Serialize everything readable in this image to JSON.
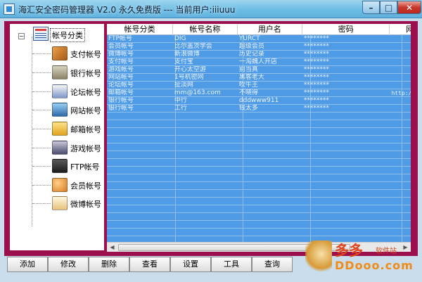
{
  "window": {
    "title": "海汇安全密码管理器 V2.0 永久免费版 --- 当前用户:iiiuuu",
    "minimize_glyph": "–",
    "maximize_glyph": "□",
    "close_glyph": "✕"
  },
  "tree": {
    "expander": "−",
    "root_label": "帐号分类",
    "root_icon": "category-list-icon",
    "items": [
      {
        "label": "支付帐号",
        "icon": "payment-icon"
      },
      {
        "label": "银行帐号",
        "icon": "bank-icon"
      },
      {
        "label": "论坛帐号",
        "icon": "forum-icon"
      },
      {
        "label": "网站帐号",
        "icon": "website-icon"
      },
      {
        "label": "邮箱帐号",
        "icon": "mailbox-icon"
      },
      {
        "label": "游戏帐号",
        "icon": "gamepad-icon"
      },
      {
        "label": "FTP帐号",
        "icon": "ftp-icon"
      },
      {
        "label": "会员帐号",
        "icon": "member-icon"
      },
      {
        "label": "微博帐号",
        "icon": "weibo-icon"
      }
    ]
  },
  "table": {
    "columns": [
      "帐号分类",
      "帐号名称",
      "用户名",
      "密码",
      "网"
    ],
    "rows": [
      [
        "FTP帐号",
        "DIG",
        "YURCT",
        "********",
        ""
      ],
      [
        "会员帐号",
        "比尔盖茨学会",
        "超级会员",
        "********",
        ""
      ],
      [
        "微博帐号",
        "新浪微博",
        "历史记录",
        "********",
        ""
      ],
      [
        "支付帐号",
        "支付宝",
        "一淘魏人开店",
        "********",
        ""
      ],
      [
        "游戏帐号",
        "开心太空游",
        "别当真",
        "********",
        ""
      ],
      [
        "网站帐号",
        "1号机密网",
        "黑客老大",
        "********",
        ""
      ],
      [
        "论坛帐号",
        "扯淡网",
        "吹牛王",
        "********",
        ""
      ],
      [
        "邮箱帐号",
        "mm@163.com",
        "不晓得",
        "********",
        "http://ww"
      ],
      [
        "银行帐号",
        "中行",
        "dddwww911",
        "********",
        ""
      ],
      [
        "银行帐号",
        "工行",
        "钱太多",
        "********",
        ""
      ]
    ]
  },
  "scrollbar": {
    "left_arrow": "◀",
    "right_arrow": "▶"
  },
  "toolbar": {
    "buttons": [
      "添加",
      "修改",
      "删除",
      "查看",
      "设置",
      "工具",
      "查询"
    ]
  },
  "watermark": {
    "title": "多多",
    "subtitle": "软件站",
    "url": "DDooo.com"
  }
}
